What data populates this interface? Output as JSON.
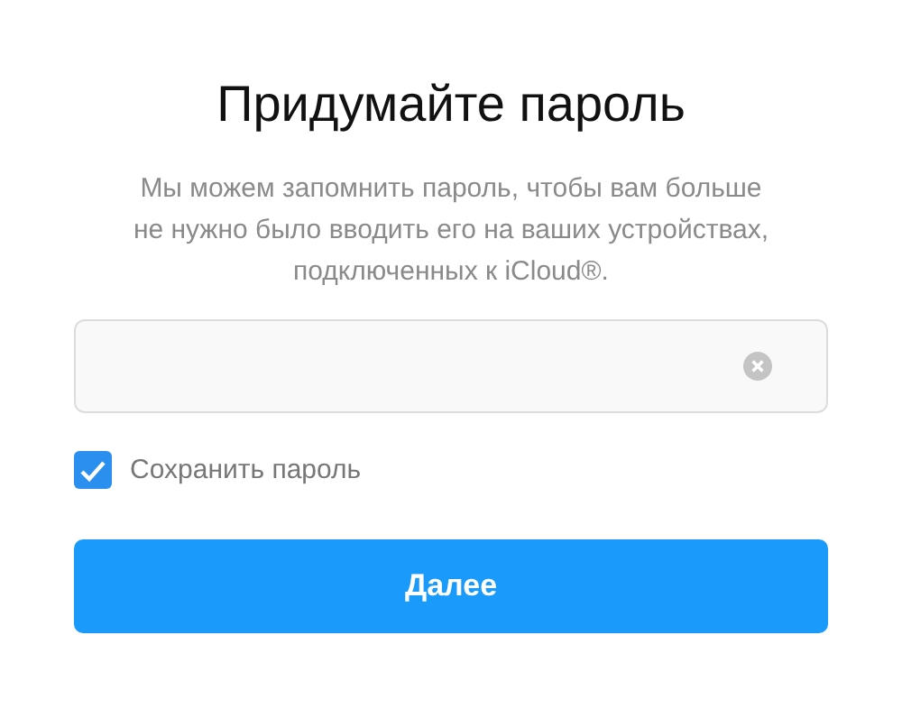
{
  "title": "Придумайте пароль",
  "description_lines": [
    "Мы можем запомнить пароль, чтобы вам больше",
    "не нужно было вводить его на ваших устройствах,",
    "подключенных к iCloud®."
  ],
  "save_password": {
    "label": "Сохранить пароль",
    "checked": true
  },
  "next_button": {
    "label": "Далее"
  }
}
